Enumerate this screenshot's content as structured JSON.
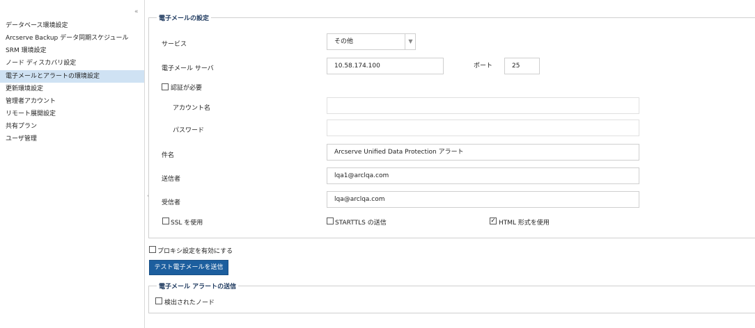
{
  "sidebar": {
    "items": [
      {
        "label": "データベース環境設定",
        "active": false
      },
      {
        "label": "Arcserve Backup データ同期スケジュール",
        "active": false
      },
      {
        "label": "SRM 環境設定",
        "active": false
      },
      {
        "label": "ノード ディスカバリ設定",
        "active": false
      },
      {
        "label": "電子メールとアラートの環境設定",
        "active": true
      },
      {
        "label": "更新環境設定",
        "active": false
      },
      {
        "label": "管理者アカウント",
        "active": false
      },
      {
        "label": "リモート展開設定",
        "active": false
      },
      {
        "label": "共有プラン",
        "active": false
      },
      {
        "label": "ユーザ管理",
        "active": false
      }
    ],
    "collapse_glyph": "«",
    "handle_glyph": "‹"
  },
  "email": {
    "legend": "電子メールの設定",
    "service_label": "サービス",
    "service_value": "その他",
    "server_label": "電子メール サーバ",
    "server_value": "10.58.174.100",
    "port_label": "ポート",
    "port_value": "25",
    "auth_label": "認証が必要",
    "auth_checked": false,
    "account_label": "アカウント名",
    "account_value": "",
    "password_label": "パスワード",
    "password_value": "",
    "subject_label": "件名",
    "subject_value": "Arcserve Unified Data Protection アラート",
    "sender_label": "送信者",
    "sender_value": "lqa1@arclqa.com",
    "recipient_label": "受信者",
    "recipient_value": "lqa@arclqa.com",
    "ssl_label": "SSL を使用",
    "ssl_checked": false,
    "starttls_label": "STARTTLS の送信",
    "starttls_checked": false,
    "html_label": "HTML 形式を使用",
    "html_checked": true
  },
  "proxy": {
    "label": "プロキシ設定を有効にする",
    "checked": false
  },
  "test_button": "テスト電子メールを送信",
  "alerts": {
    "legend": "電子メール アラートの送信",
    "detected_nodes_label": "検出されたノード",
    "detected_nodes_checked": false
  },
  "glyphs": {
    "check": "✓",
    "dropdown": "▼"
  },
  "colors": {
    "active_nav": "#cfe2f3",
    "button": "#1c5e9e",
    "legend_text": "#1f3a5f"
  }
}
